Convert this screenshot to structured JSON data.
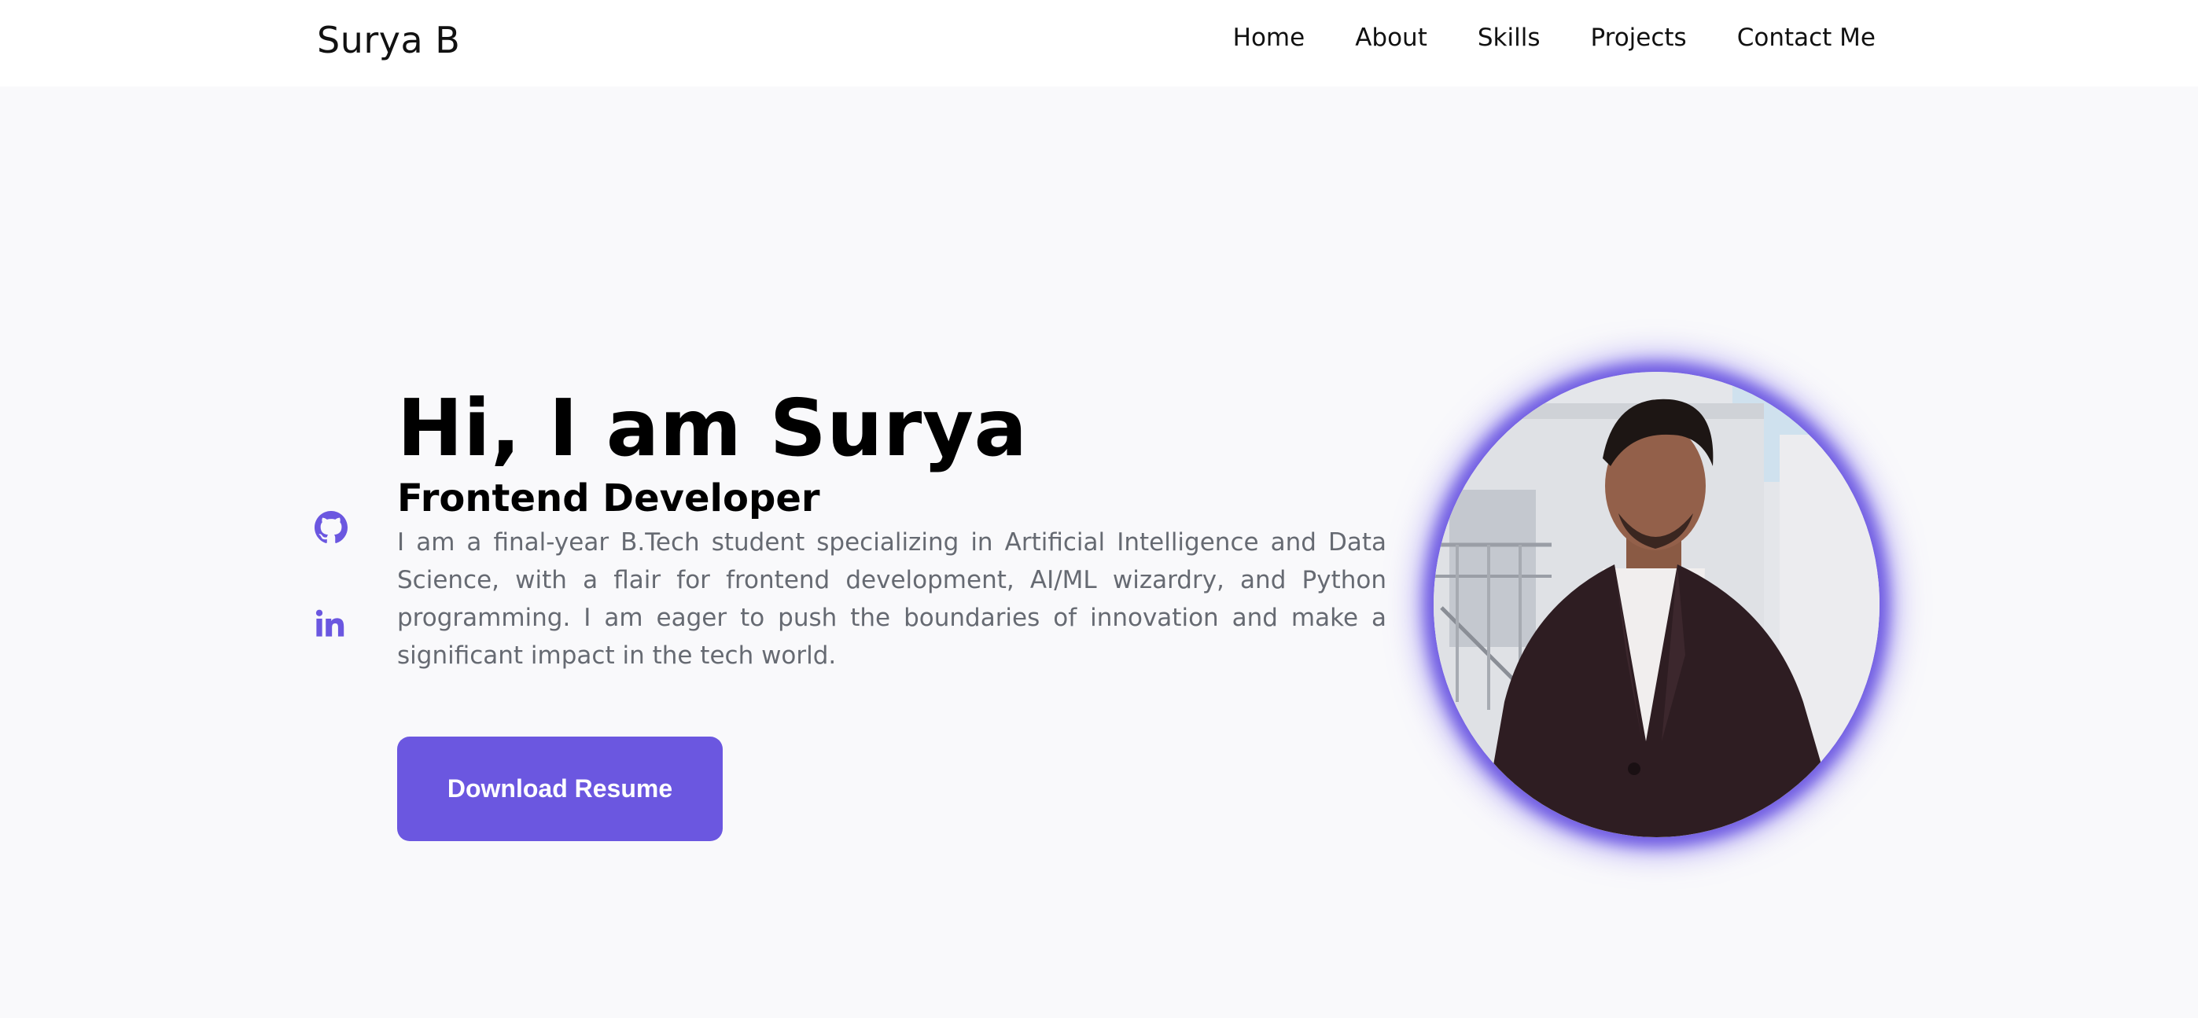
{
  "navbar": {
    "logo": "Surya B",
    "links": [
      "Home",
      "About",
      "Skills",
      "Projects",
      "Contact Me"
    ]
  },
  "socials": {
    "items": [
      {
        "icon": "github-icon"
      },
      {
        "icon": "linkedin-icon"
      }
    ],
    "color": "#6b57e0"
  },
  "hero": {
    "title": "Hi, I am Surya",
    "subtitle": "Frontend Developer",
    "description": "I am a final-year B.Tech student specializing in Artificial Intelligence and Data Science, with a flair for frontend development, AI/ML wizardry, and Python programming. I am eager to push the boundaries of innovation and make a significant impact in the tech world.",
    "button_label": "Download Resume"
  },
  "colors": {
    "accent": "#6b57e0",
    "background": "#f9f9fb",
    "text": "#000000",
    "muted_text": "#666a72"
  }
}
